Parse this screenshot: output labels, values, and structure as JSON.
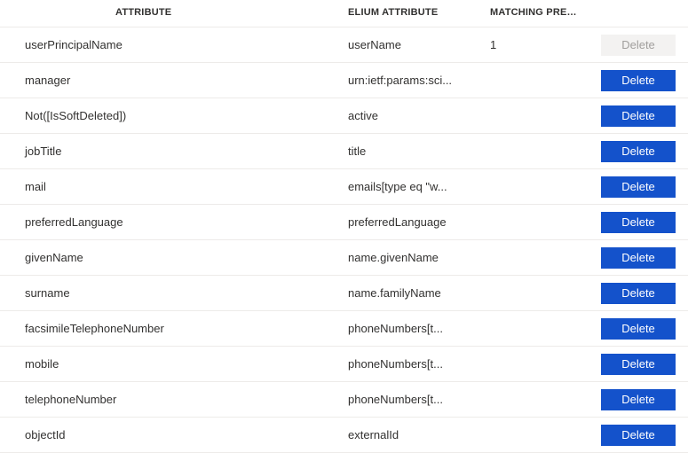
{
  "headers": {
    "attribute": "ATTRIBUTE",
    "elium": "ELIUM ATTRIBUTE",
    "precedence": "MATCHING PREC..."
  },
  "delete_label": "Delete",
  "rows": [
    {
      "attribute": "userPrincipalName",
      "elium": "userName",
      "precedence": "1",
      "deletable": false
    },
    {
      "attribute": "manager",
      "elium": "urn:ietf:params:sci...",
      "precedence": "",
      "deletable": true
    },
    {
      "attribute": "Not([IsSoftDeleted])",
      "elium": "active",
      "precedence": "",
      "deletable": true
    },
    {
      "attribute": "jobTitle",
      "elium": "title",
      "precedence": "",
      "deletable": true
    },
    {
      "attribute": "mail",
      "elium": "emails[type eq \"w...",
      "precedence": "",
      "deletable": true
    },
    {
      "attribute": "preferredLanguage",
      "elium": "preferredLanguage",
      "precedence": "",
      "deletable": true
    },
    {
      "attribute": "givenName",
      "elium": "name.givenName",
      "precedence": "",
      "deletable": true
    },
    {
      "attribute": "surname",
      "elium": "name.familyName",
      "precedence": "",
      "deletable": true
    },
    {
      "attribute": "facsimileTelephoneNumber",
      "elium": "phoneNumbers[t...",
      "precedence": "",
      "deletable": true
    },
    {
      "attribute": "mobile",
      "elium": "phoneNumbers[t...",
      "precedence": "",
      "deletable": true
    },
    {
      "attribute": "telephoneNumber",
      "elium": "phoneNumbers[t...",
      "precedence": "",
      "deletable": true
    },
    {
      "attribute": "objectId",
      "elium": "externalId",
      "precedence": "",
      "deletable": true
    }
  ]
}
